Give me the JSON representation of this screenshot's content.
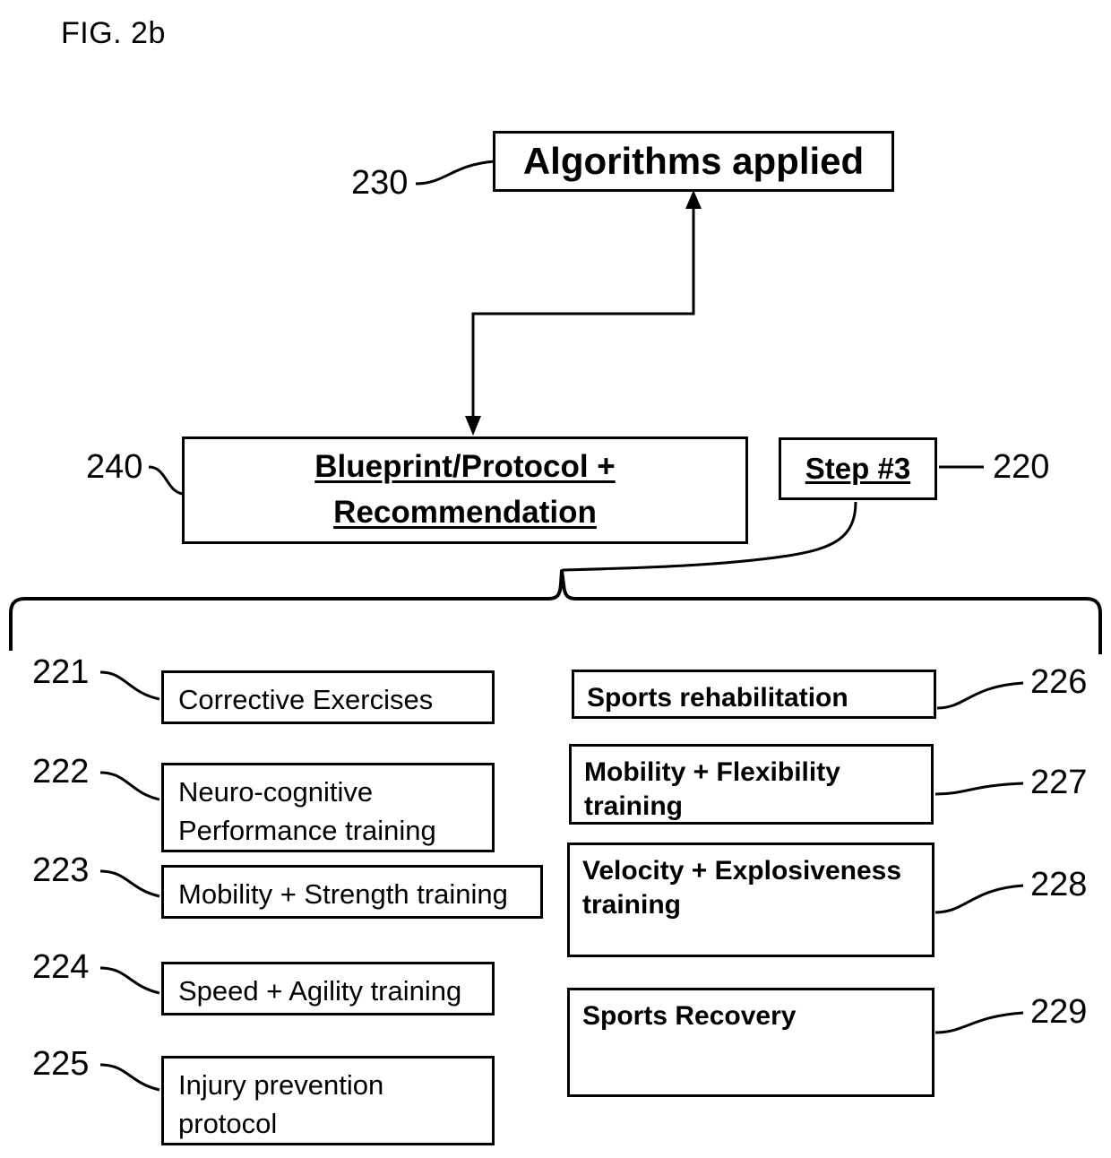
{
  "figure": {
    "label": "FIG. 2b"
  },
  "nodes": {
    "algorithms": {
      "ref": "230",
      "text": "Algorithms applied"
    },
    "blueprint": {
      "ref": "240",
      "text": "Blueprint/Protocol +\nRecommendation"
    },
    "step": {
      "ref": "220",
      "text": "Step #3"
    }
  },
  "left_column": [
    {
      "ref": "221",
      "text": "Corrective Exercises"
    },
    {
      "ref": "222",
      "text": "Neuro-cognitive\nPerformance training"
    },
    {
      "ref": "223",
      "text": "Mobility + Strength training"
    },
    {
      "ref": "224",
      "text": "Speed + Agility training"
    },
    {
      "ref": "225",
      "text": "Injury prevention\nprotocol"
    }
  ],
  "right_column": [
    {
      "ref": "226",
      "text": "Sports rehabilitation"
    },
    {
      "ref": "227",
      "text": "Mobility + Flexibility\ntraining"
    },
    {
      "ref": "228",
      "text": "Velocity + Explosiveness\ntraining"
    },
    {
      "ref": "229",
      "text": "Sports Recovery"
    }
  ],
  "colors": {
    "stroke": "#000000",
    "background": "#ffffff"
  }
}
